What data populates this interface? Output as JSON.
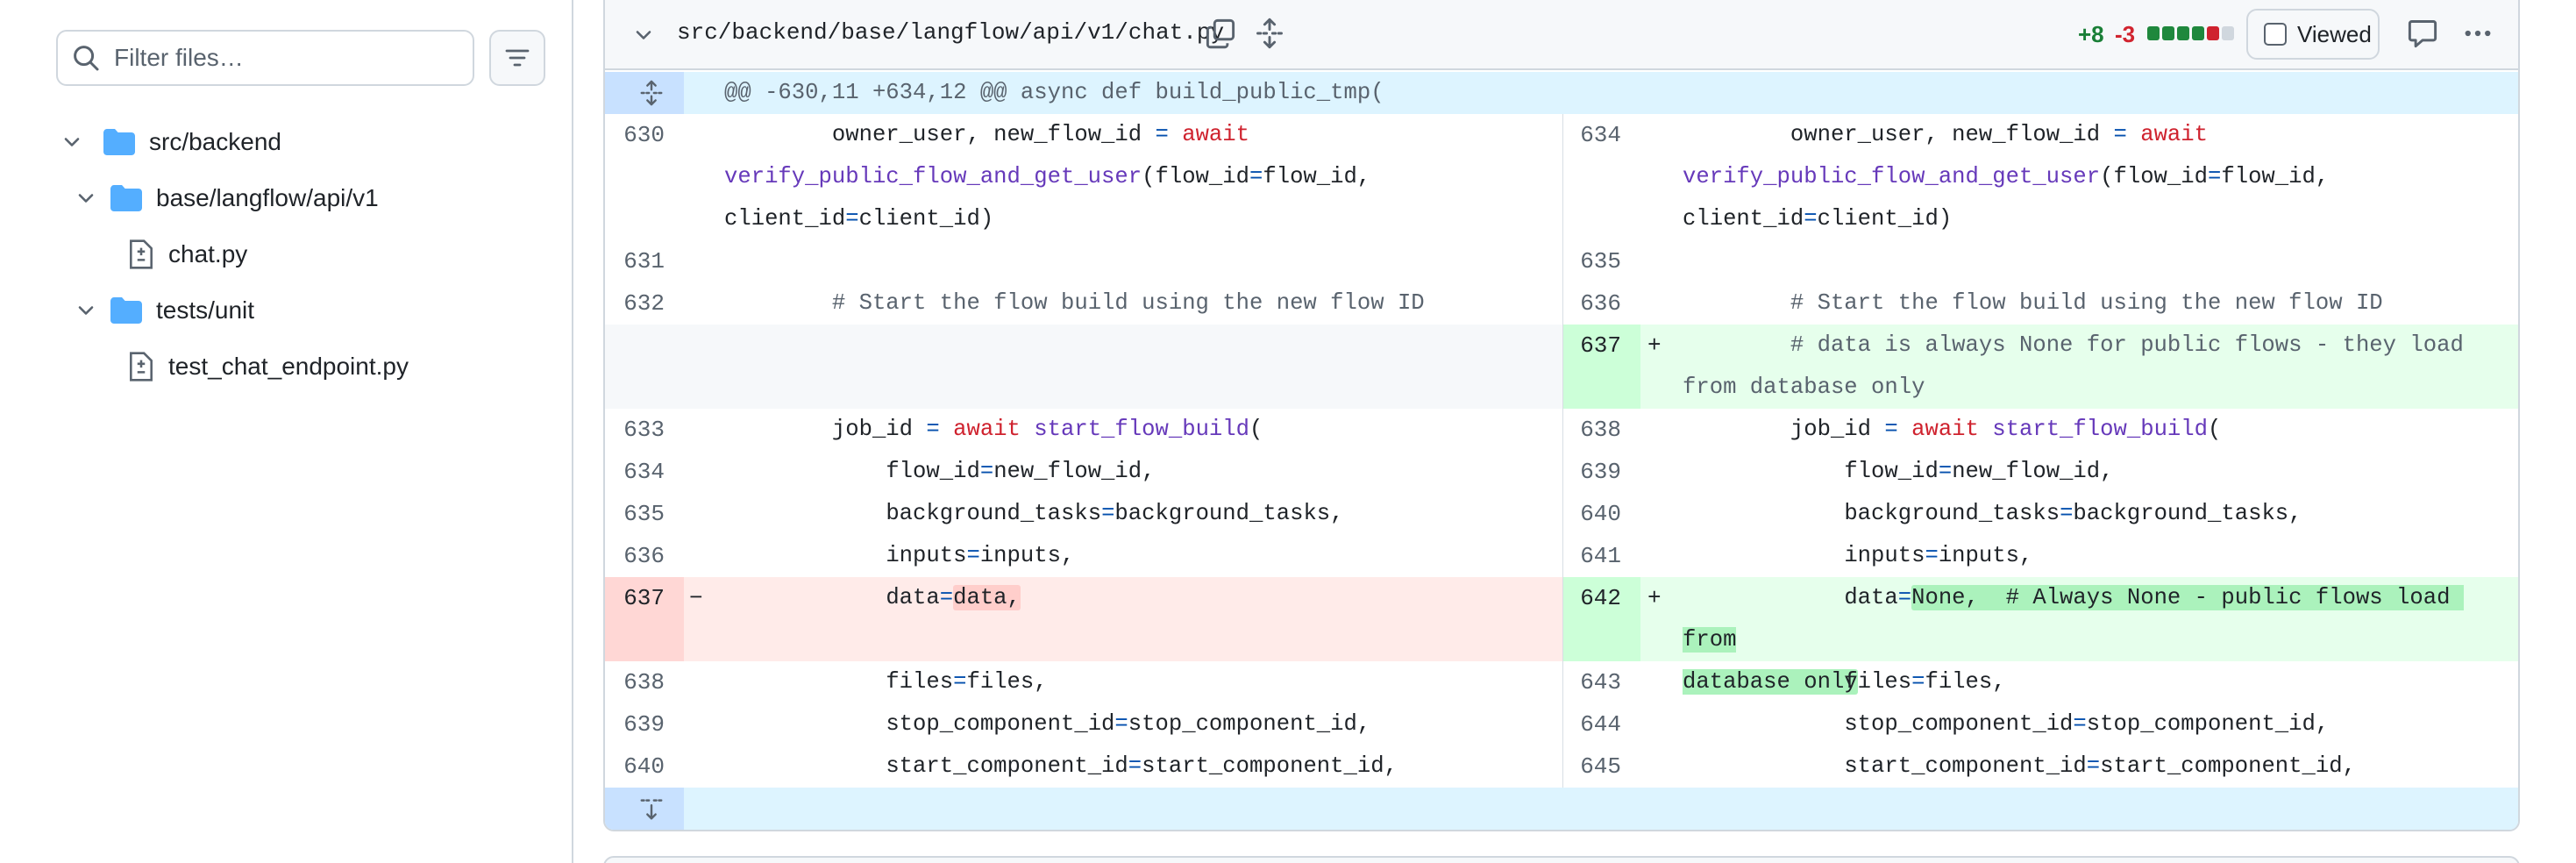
{
  "sidebar": {
    "filter_placeholder": "Filter files…",
    "tree": [
      {
        "label": "src/backend",
        "type": "folder",
        "expanded": true,
        "level": 0
      },
      {
        "label": "base/langflow/api/v1",
        "type": "folder",
        "expanded": true,
        "level": 1
      },
      {
        "label": "chat.py",
        "type": "file",
        "level": 2
      },
      {
        "label": "tests/unit",
        "type": "folder",
        "expanded": true,
        "level": 1
      },
      {
        "label": "test_chat_endpoint.py",
        "type": "file",
        "level": 2
      }
    ]
  },
  "file_header": {
    "path": "src/backend/base/langflow/api/v1/chat.py",
    "additions": "+8",
    "deletions": "-3",
    "diffstat": [
      "add",
      "add",
      "add",
      "add",
      "del",
      "neutral"
    ],
    "viewed_label": "Viewed",
    "viewed_checked": false
  },
  "diff": {
    "hunk_header": "@@ -630,11 +634,12 @@ async def build_public_tmp(",
    "rows": [
      {
        "left_num": "630",
        "right_num": "634",
        "left": [
          [
            "        owner_user, new_flow_id ",
            ""
          ],
          [
            "=",
            "op"
          ],
          [
            " ",
            ""
          ],
          [
            "await",
            "kw"
          ],
          [
            "\nverify_public_flow_and_get_user",
            "fn"
          ],
          [
            "(flow_id",
            ""
          ],
          [
            "=",
            "op"
          ],
          [
            "flow_id,\nclient_id",
            ""
          ],
          [
            "=",
            "op"
          ],
          [
            "client_id)",
            ""
          ]
        ],
        "right": [
          [
            "        owner_user, new_flow_id ",
            ""
          ],
          [
            "=",
            "op"
          ],
          [
            " ",
            ""
          ],
          [
            "await",
            "kw"
          ],
          [
            "\nverify_public_flow_and_get_user",
            "fn"
          ],
          [
            "(flow_id",
            ""
          ],
          [
            "=",
            "op"
          ],
          [
            "flow_id,\nclient_id",
            ""
          ],
          [
            "=",
            "op"
          ],
          [
            "client_id)",
            ""
          ]
        ]
      },
      {
        "left_num": "631",
        "right_num": "635",
        "left": [
          [
            "",
            ""
          ]
        ],
        "right": [
          [
            "",
            ""
          ]
        ]
      },
      {
        "left_num": "632",
        "right_num": "636",
        "left": [
          [
            "        # Start the flow build using the new flow ID",
            "cm"
          ]
        ],
        "right": [
          [
            "        # Start the flow build using the new flow ID",
            "cm"
          ]
        ]
      },
      {
        "left_num": "",
        "right_num": "637",
        "left_type": "empty",
        "right_type": "add",
        "right_sign": "+",
        "left": [],
        "right": [
          [
            "        # data is always None for public flows - they load\nfrom database only",
            "cm"
          ]
        ]
      },
      {
        "left_num": "633",
        "right_num": "638",
        "left": [
          [
            "        job_id ",
            ""
          ],
          [
            "=",
            "op"
          ],
          [
            " ",
            ""
          ],
          [
            "await",
            "kw"
          ],
          [
            " ",
            ""
          ],
          [
            "start_flow_build",
            "fn"
          ],
          [
            "(",
            ""
          ]
        ],
        "right": [
          [
            "        job_id ",
            ""
          ],
          [
            "=",
            "op"
          ],
          [
            " ",
            ""
          ],
          [
            "await",
            "kw"
          ],
          [
            " ",
            ""
          ],
          [
            "start_flow_build",
            "fn"
          ],
          [
            "(",
            ""
          ]
        ]
      },
      {
        "left_num": "634",
        "right_num": "639",
        "left": [
          [
            "            flow_id",
            ""
          ],
          [
            "=",
            "op"
          ],
          [
            "new_flow_id,",
            ""
          ]
        ],
        "right": [
          [
            "            flow_id",
            ""
          ],
          [
            "=",
            "op"
          ],
          [
            "new_flow_id,",
            ""
          ]
        ]
      },
      {
        "left_num": "635",
        "right_num": "640",
        "left": [
          [
            "            background_tasks",
            ""
          ],
          [
            "=",
            "op"
          ],
          [
            "background_tasks,",
            ""
          ]
        ],
        "right": [
          [
            "            background_tasks",
            ""
          ],
          [
            "=",
            "op"
          ],
          [
            "background_tasks,",
            ""
          ]
        ]
      },
      {
        "left_num": "636",
        "right_num": "641",
        "left": [
          [
            "            inputs",
            ""
          ],
          [
            "=",
            "op"
          ],
          [
            "inputs,",
            ""
          ]
        ],
        "right": [
          [
            "            inputs",
            ""
          ],
          [
            "=",
            "op"
          ],
          [
            "inputs,",
            ""
          ]
        ]
      },
      {
        "left_num": "637",
        "right_num": "642",
        "left_type": "del",
        "right_type": "add",
        "left_sign": "−",
        "right_sign": "+",
        "left": [
          [
            "            data",
            ""
          ],
          [
            "=",
            "op"
          ],
          [
            "data,",
            "hl-del"
          ]
        ],
        "right": [
          [
            "            data",
            ""
          ],
          [
            "=",
            "op"
          ],
          [
            "None,  # Always None - public flows load from\ndatabase only",
            "hl-add"
          ]
        ]
      },
      {
        "left_num": "638",
        "right_num": "643",
        "left": [
          [
            "            files",
            ""
          ],
          [
            "=",
            "op"
          ],
          [
            "files,",
            ""
          ]
        ],
        "right": [
          [
            "            files",
            ""
          ],
          [
            "=",
            "op"
          ],
          [
            "files,",
            ""
          ]
        ]
      },
      {
        "left_num": "639",
        "right_num": "644",
        "left": [
          [
            "            stop_component_id",
            ""
          ],
          [
            "=",
            "op"
          ],
          [
            "stop_component_id,",
            ""
          ]
        ],
        "right": [
          [
            "            stop_component_id",
            ""
          ],
          [
            "=",
            "op"
          ],
          [
            "stop_component_id,",
            ""
          ]
        ]
      },
      {
        "left_num": "640",
        "right_num": "645",
        "left": [
          [
            "            start_component_id",
            ""
          ],
          [
            "=",
            "op"
          ],
          [
            "start_component_id,",
            ""
          ]
        ],
        "right": [
          [
            "            start_component_id",
            ""
          ],
          [
            "=",
            "op"
          ],
          [
            "start_component_id,",
            ""
          ]
        ]
      }
    ]
  },
  "colors": {
    "addition": "#1a7f37",
    "deletion": "#d1242f",
    "add_bg": "#e6ffec",
    "del_bg": "#ffebe9",
    "hunk_bg": "#ddf4ff",
    "folder": "#54aeff"
  },
  "icons": {
    "search": "search-icon",
    "filter": "filter-icon",
    "chevron": "chevron-down-icon",
    "folder": "folder-icon",
    "file": "file-diff-icon",
    "copy": "copy-icon",
    "expand": "unfold-icon",
    "comment": "comment-icon",
    "more": "kebab-horizontal-icon"
  }
}
